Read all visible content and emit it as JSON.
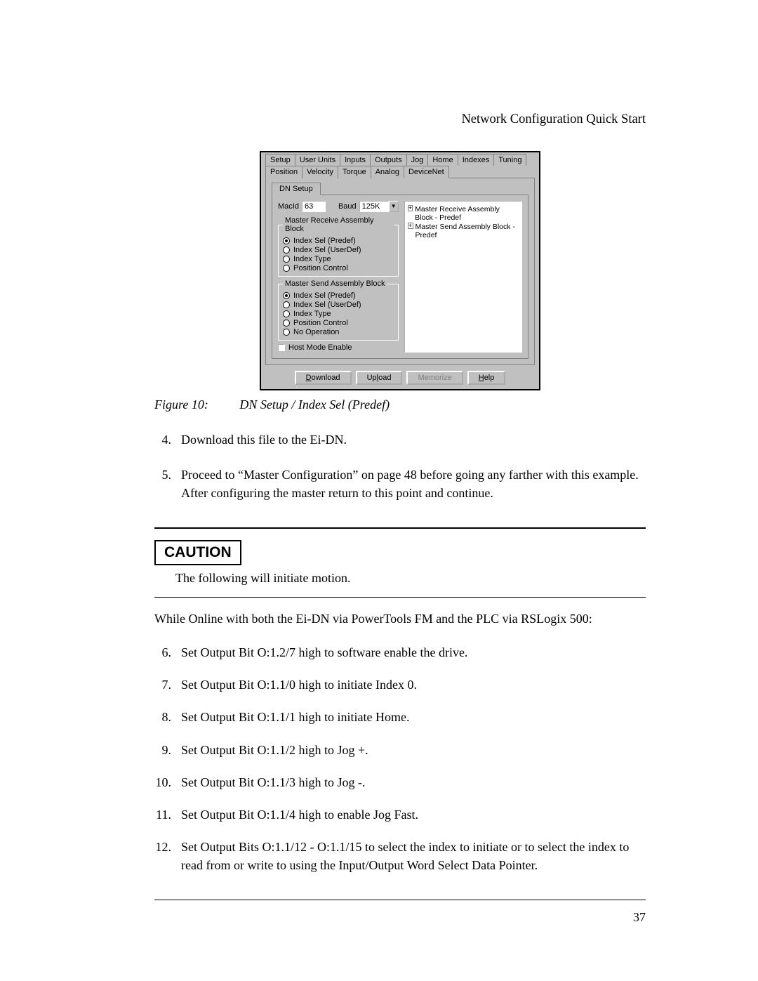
{
  "header": "Network Configuration Quick Start",
  "dialog": {
    "tabs_row1": [
      "Setup",
      "User Units",
      "Inputs",
      "Outputs",
      "Jog",
      "Home",
      "Indexes",
      "Tuning"
    ],
    "tabs_row2": [
      "Position",
      "Velocity",
      "Torque",
      "Analog",
      "DeviceNet"
    ],
    "active_top_tab": "DeviceNet",
    "inner_tab": "DN Setup",
    "macid_label": "MacId",
    "macid_value": "63",
    "baud_label": "Baud",
    "baud_value": "125K",
    "recv_legend": "Master Receive Assembly Block",
    "recv_opts": [
      "Index Sel (Predef)",
      "Index Sel (UserDef)",
      "Index Type",
      "Position Control"
    ],
    "recv_selected": 0,
    "send_legend": "Master Send Assembly Block",
    "send_opts": [
      "Index Sel (Predef)",
      "Index Sel (UserDef)",
      "Index Type",
      "Position Control",
      "No Operation"
    ],
    "send_selected": 0,
    "host_mode": "Host Mode Enable",
    "tree": [
      "Master Receive Assembly Block - Predef",
      "Master Send Assembly Block - Predef"
    ],
    "btn_download": "Download",
    "btn_upload": "Upload",
    "btn_memorize": "Memorize",
    "btn_help": "Help"
  },
  "figure": {
    "label": "Figure 10:",
    "title": "DN Setup / Index Sel (Predef)"
  },
  "steps_before": [
    {
      "n": "4.",
      "text": "Download this file to the Ei-DN."
    },
    {
      "n": "5.",
      "text": "Proceed to “Master Configuration” on page 48 before going any farther with this example. After configuring the master return to this point and continue."
    }
  ],
  "caution_label": "CAUTION",
  "caution_text": "The following will initiate motion.",
  "online_text": "While Online with both the Ei-DN via PowerTools FM and the PLC via RSLogix 500:",
  "steps_after": [
    {
      "n": "6.",
      "text": "Set Output Bit O:1.2/7 high to software enable the drive."
    },
    {
      "n": "7.",
      "text": "Set Output Bit O:1.1/0 high to initiate Index 0."
    },
    {
      "n": "8.",
      "text": "Set Output Bit O:1.1/1 high to initiate Home."
    },
    {
      "n": "9.",
      "text": "Set Output Bit O:1.1/2 high to Jog +."
    },
    {
      "n": "10.",
      "text": "Set Output Bit O:1.1/3 high to Jog -."
    },
    {
      "n": "11.",
      "text": "Set Output Bit O:1.1/4 high to enable Jog Fast."
    },
    {
      "n": "12.",
      "text": "Set Output Bits O:1.1/12 - O:1.1/15 to select the index to initiate or to select the index to read from or write to using the Input/Output Word Select Data Pointer."
    }
  ],
  "page_number": "37"
}
